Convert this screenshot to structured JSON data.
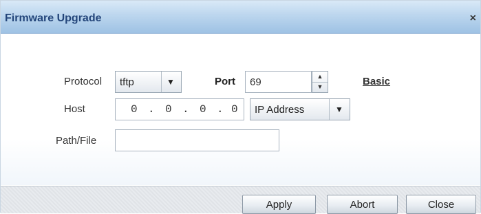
{
  "dialog": {
    "title": "Firmware Upgrade",
    "close_glyph": "×"
  },
  "form": {
    "protocol": {
      "label": "Protocol",
      "value": "tftp",
      "arrow": "▼"
    },
    "port": {
      "label": "Port",
      "value": "69",
      "up": "▲",
      "down": "▼"
    },
    "basic_link": "Basic",
    "host": {
      "label": "Host",
      "ip_octets": [
        "0",
        "0",
        "0",
        "0"
      ],
      "dot": ".",
      "type_value": "IP Address",
      "arrow": "▼"
    },
    "path_file": {
      "label": "Path/File",
      "value": ""
    }
  },
  "footer": {
    "apply_label": "Apply",
    "abort_label": "Abort",
    "close_label": "Close"
  },
  "icons": {
    "close": "close-icon",
    "dropdown": "chevron-down-icon",
    "spin_up": "spin-up-icon",
    "spin_down": "spin-down-icon"
  }
}
